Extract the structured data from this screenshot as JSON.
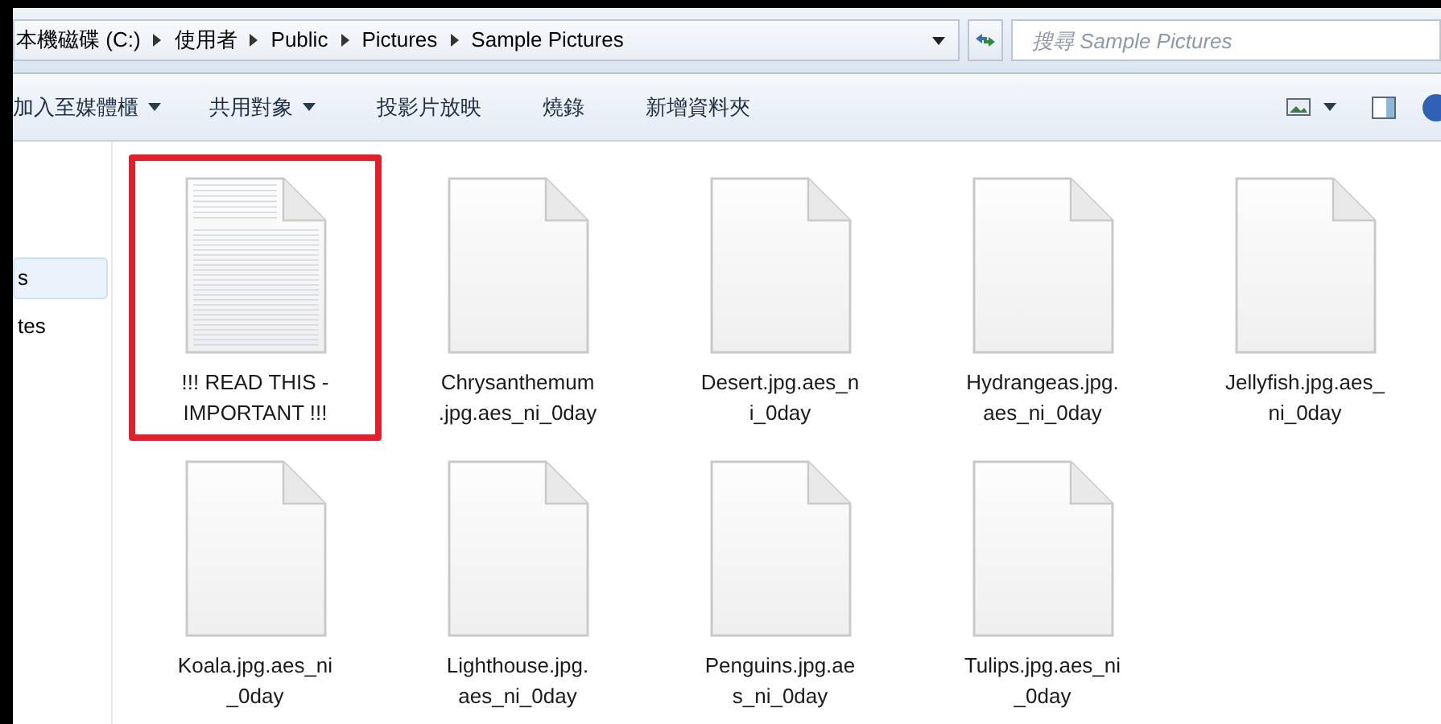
{
  "address_bar": {
    "breadcrumbs": [
      "本機磁碟 (C:)",
      "使用者",
      "Public",
      "Pictures",
      "Sample Pictures"
    ]
  },
  "search": {
    "placeholder": "搜尋 Sample Pictures"
  },
  "toolbar": {
    "buttons": [
      {
        "label": "加入至媒體櫃",
        "dropdown": true
      },
      {
        "label": "共用對象",
        "dropdown": true
      },
      {
        "label": "投影片放映",
        "dropdown": false
      },
      {
        "label": "燒錄",
        "dropdown": false
      },
      {
        "label": "新增資料夾",
        "dropdown": false
      }
    ]
  },
  "sidebar": {
    "items": [
      {
        "label": "s",
        "selected": true
      },
      {
        "label": "tes",
        "selected": false
      }
    ]
  },
  "files": [
    {
      "kind": "text",
      "lines": [
        "!!! READ THIS -",
        "IMPORTANT !!!"
      ],
      "marked": true
    },
    {
      "kind": "blank",
      "lines": [
        "Chrysanthemum",
        ".jpg.aes_ni_0day"
      ],
      "marked": false
    },
    {
      "kind": "blank",
      "lines": [
        "Desert.jpg.aes_n",
        "i_0day"
      ],
      "marked": false
    },
    {
      "kind": "blank",
      "lines": [
        "Hydrangeas.jpg.",
        "aes_ni_0day"
      ],
      "marked": false
    },
    {
      "kind": "blank",
      "lines": [
        "Jellyfish.jpg.aes_",
        "ni_0day"
      ],
      "marked": false
    },
    {
      "kind": "blank",
      "lines": [
        "Koala.jpg.aes_ni",
        "_0day"
      ],
      "marked": false
    },
    {
      "kind": "blank",
      "lines": [
        "Lighthouse.jpg.",
        "aes_ni_0day"
      ],
      "marked": false
    },
    {
      "kind": "blank",
      "lines": [
        "Penguins.jpg.ae",
        "s_ni_0day"
      ],
      "marked": false
    },
    {
      "kind": "blank",
      "lines": [
        "Tulips.jpg.aes_ni",
        "_0day"
      ],
      "marked": false
    }
  ]
}
